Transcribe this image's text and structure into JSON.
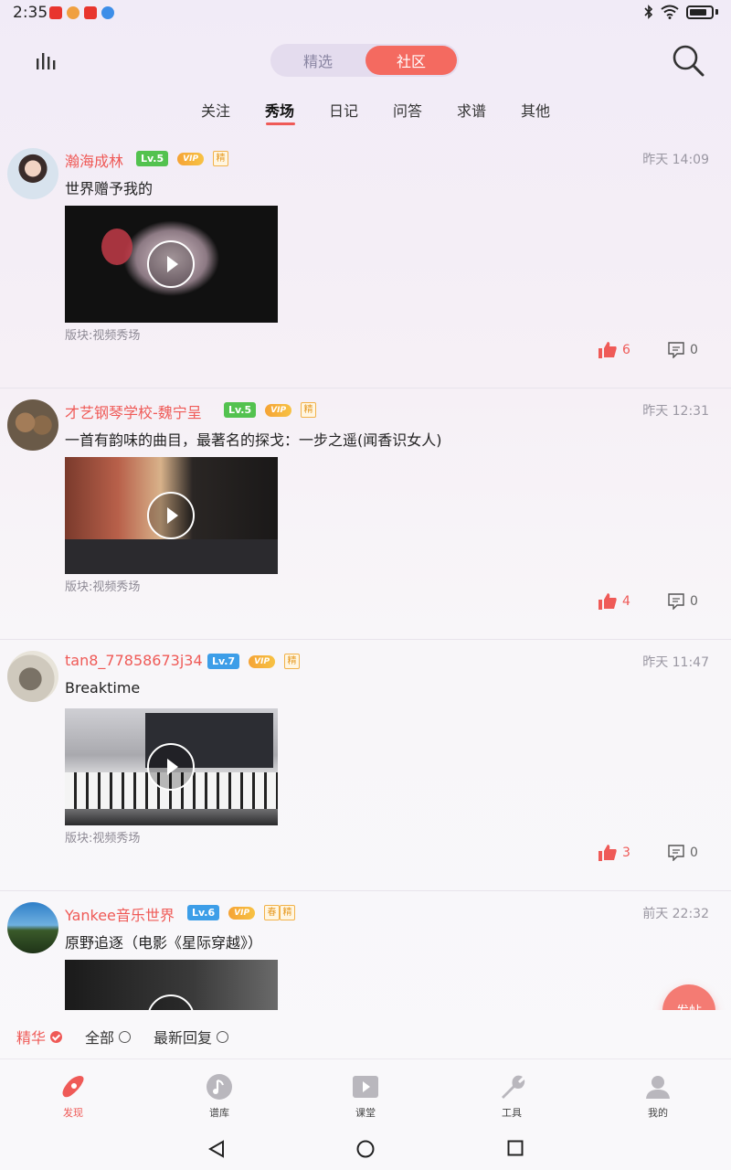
{
  "status_bar": {
    "time": "2:35"
  },
  "header": {
    "toggle": {
      "left": "精选",
      "right": "社区"
    },
    "tabs": [
      "关注",
      "秀场",
      "日记",
      "问答",
      "求谱",
      "其他"
    ],
    "active_tab": "秀场"
  },
  "posts": [
    {
      "username": "瀚海成林",
      "level": "Lv.5",
      "level_color": "#53c24f",
      "vip": "VIP",
      "tags": [
        "精"
      ],
      "time": "昨天 14:09",
      "content": "世界赠予我的",
      "section": "版块:视频秀场",
      "likes": "6",
      "comments": "0"
    },
    {
      "username": "才艺钢琴学校-魏宁呈",
      "level": "Lv.5",
      "level_color": "#53c24f",
      "vip": "VIP",
      "tags": [
        "精"
      ],
      "time": "昨天 12:31",
      "content": "一首有韵味的曲目，最著名的探戈：一步之遥(闻香识女人)",
      "section": "版块:视频秀场",
      "likes": "4",
      "comments": "0"
    },
    {
      "username": "tan8_77858673j34",
      "level": "Lv.7",
      "level_color": "#3d9ee8",
      "vip": "VIP",
      "tags": [
        "精"
      ],
      "time": "昨天 11:47",
      "content": "Breaktime",
      "section": "版块:视频秀场",
      "likes": "3",
      "comments": "0"
    },
    {
      "username": "Yankee音乐世界",
      "level": "Lv.6",
      "level_color": "#3d9ee8",
      "vip": "VIP",
      "tags": [
        "春",
        "精"
      ],
      "time": "前天 22:32",
      "content": "原野追逐（电影《星际穿越》）",
      "section": "",
      "likes": "",
      "comments": ""
    }
  ],
  "fab_label": "发帖",
  "filters": [
    {
      "label": "精华",
      "checked": true
    },
    {
      "label": "全部",
      "checked": false
    },
    {
      "label": "最新回复",
      "checked": false
    }
  ],
  "bottom_nav": [
    {
      "label": "发现",
      "icon": "discover-icon",
      "active": true
    },
    {
      "label": "谱库",
      "icon": "music-note-icon",
      "active": false
    },
    {
      "label": "课堂",
      "icon": "play-class-icon",
      "active": false
    },
    {
      "label": "工具",
      "icon": "wrench-icon",
      "active": false
    },
    {
      "label": "我的",
      "icon": "profile-icon",
      "active": false
    }
  ],
  "colors": {
    "accent": "#ef5a57",
    "toggle_active": "#f46a60"
  }
}
